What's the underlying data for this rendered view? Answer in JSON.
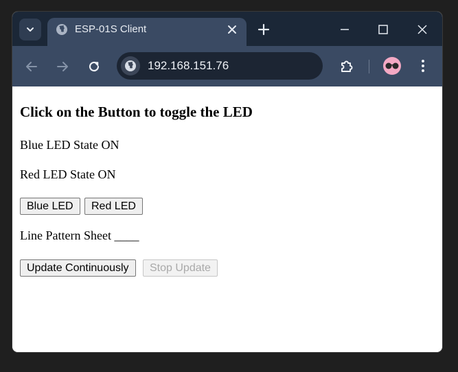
{
  "tab": {
    "title": "ESP-01S Client"
  },
  "toolbar": {
    "url": "192.168.151.76"
  },
  "page": {
    "heading": "Click on the Button to toggle the LED",
    "blue_state": "Blue LED State ON",
    "red_state": "Red LED State ON",
    "blue_button": "Blue LED",
    "red_button": "Red LED",
    "line_pattern": "Line Pattern Sheet ____",
    "update_button": "Update Continuously",
    "stop_button": "Stop Update"
  },
  "colors": {
    "tabstrip": "#1b2737",
    "toolbar": "#3a4a63",
    "omnibox": "#1c2533",
    "avatar": "#f4a9c4"
  }
}
